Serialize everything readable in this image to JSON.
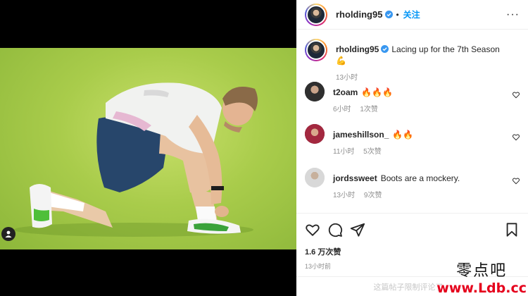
{
  "header": {
    "username": "rholding95",
    "follow_label": "关注",
    "dot": "•",
    "more_label": "···"
  },
  "caption": {
    "username": "rholding95",
    "text": "Lacing up for the 7th Season 💪",
    "time": "13小时"
  },
  "comments": [
    {
      "username": "t2oam",
      "text": "🔥🔥🔥",
      "time": "6小时",
      "likes": "1次赞"
    },
    {
      "username": "jameshillson_",
      "text": "🔥🔥",
      "time": "11小时",
      "likes": "5次赞"
    },
    {
      "username": "jordssweet",
      "text": "Boots are a mockery.",
      "time": "13小时",
      "likes": "9次赞"
    }
  ],
  "actions": {
    "likes": "1.6 万次赞",
    "posted": "13小时前"
  },
  "comment_bar": "这篇帖子限制评论了。",
  "watermark": {
    "line1": "零点吧",
    "line2": "www.Ldb.cc"
  },
  "colors": {
    "link": "#0095f6",
    "muted": "#8e8e8e",
    "verified": "#3897f0",
    "watermark_red": "#e5001c"
  },
  "icons": [
    "heart-icon",
    "comment-icon",
    "share-icon",
    "bookmark-icon",
    "verified-badge-icon",
    "more-icon",
    "tagged-user-icon"
  ]
}
